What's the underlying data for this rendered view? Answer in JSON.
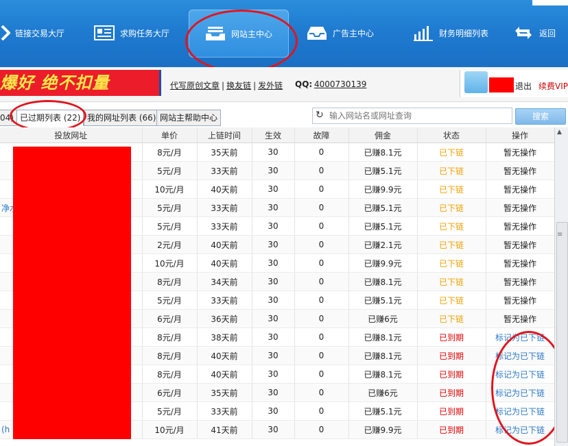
{
  "nav": {
    "items": [
      {
        "label": "链接交易大厅",
        "icon": "link-icon"
      },
      {
        "label": "求购任务大厅",
        "icon": "task-board-icon"
      },
      {
        "label": "网站主中心",
        "icon": "inbox-tray-icon"
      },
      {
        "label": "广告主中心",
        "icon": "inbox-icon"
      },
      {
        "label": "财务明细列表",
        "icon": "bar-chart-icon"
      },
      {
        "label": "返回",
        "icon": "return-arrows-icon"
      }
    ]
  },
  "banner": {
    "promo": "爆好 绝不扣量",
    "links": [
      "代写原创文章",
      "换友链",
      "发外链"
    ],
    "qq_label": "QQ:",
    "qq_number": "4000730139",
    "logout": "退出",
    "vip": "续费VIP"
  },
  "tabs": [
    {
      "label": "04)"
    },
    {
      "label": "已过期列表 (22)"
    },
    {
      "label": "我的网址列表 (66)"
    },
    {
      "label": "网站主帮助中心"
    }
  ],
  "search": {
    "placeholder": "输入网站名或网址查询",
    "button": "搜索"
  },
  "table": {
    "headers": [
      "投放网址",
      "单价",
      "上链时间",
      "生效",
      "故障",
      "佣金",
      "状态",
      "操作"
    ],
    "rows": [
      {
        "url": "",
        "price": "8元/月",
        "time": "35天前",
        "eff": "30",
        "fault": "0",
        "comm": "已赚8.1元",
        "status": "已下链",
        "op": "暂无操作"
      },
      {
        "url": "",
        "price": "5元/月",
        "time": "33天前",
        "eff": "30",
        "fault": "0",
        "comm": "已赚5.1元",
        "status": "已下链",
        "op": "暂无操作"
      },
      {
        "url": "",
        "price": "10元/月",
        "time": "40天前",
        "eff": "30",
        "fault": "0",
        "comm": "已赚9.9元",
        "status": "已下链",
        "op": "暂无操作"
      },
      {
        "url": "净水",
        "price": "5元/月",
        "time": "33天前",
        "eff": "30",
        "fault": "0",
        "comm": "已赚5.1元",
        "status": "已下链",
        "op": "暂无操作"
      },
      {
        "url": "",
        "price": "5元/月",
        "time": "33天前",
        "eff": "30",
        "fault": "0",
        "comm": "已赚5.1元",
        "status": "已下链",
        "op": "暂无操作"
      },
      {
        "url": "",
        "price": "2元/月",
        "time": "40天前",
        "eff": "30",
        "fault": "0",
        "comm": "已赚2.1元",
        "status": "已下链",
        "op": "暂无操作"
      },
      {
        "url": "",
        "price": "10元/月",
        "time": "40天前",
        "eff": "30",
        "fault": "0",
        "comm": "已赚9.9元",
        "status": "已下链",
        "op": "暂无操作"
      },
      {
        "url": "",
        "price": "8元/月",
        "time": "34天前",
        "eff": "30",
        "fault": "0",
        "comm": "已赚8.1元",
        "status": "已下链",
        "op": "暂无操作"
      },
      {
        "url": "",
        "price": "5元/月",
        "time": "33天前",
        "eff": "30",
        "fault": "0",
        "comm": "已赚5.1元",
        "status": "已下链",
        "op": "暂无操作"
      },
      {
        "url": "",
        "price": "6元/月",
        "time": "36天前",
        "eff": "30",
        "fault": "0",
        "comm": "已赚6元",
        "status": "已下链",
        "op": "暂无操作"
      },
      {
        "url": "",
        "price": "8元/月",
        "time": "38天前",
        "eff": "30",
        "fault": "0",
        "comm": "已赚8.1元",
        "status": "已到期",
        "op": "标记为已下链"
      },
      {
        "url": "",
        "price": "8元/月",
        "time": "40天前",
        "eff": "30",
        "fault": "0",
        "comm": "已赚8.1元",
        "status": "已到期",
        "op": "标记为已下链"
      },
      {
        "url": "",
        "price": "8元/月",
        "time": "40天前",
        "eff": "30",
        "fault": "0",
        "comm": "已赚8.1元",
        "status": "已到期",
        "op": "标记为已下链"
      },
      {
        "url": "",
        "price": "6元/月",
        "time": "35天前",
        "eff": "30",
        "fault": "0",
        "comm": "已赚6元",
        "status": "已到期",
        "op": "标记为已下链"
      },
      {
        "url": "",
        "price": "5元/月",
        "time": "33天前",
        "eff": "30",
        "fault": "0",
        "comm": "已赚5.1元",
        "status": "已到期",
        "op": "标记为已下链"
      },
      {
        "url": "(h",
        "price": "10元/月",
        "time": "41天前",
        "eff": "30",
        "fault": "0",
        "comm": "已赚9.9元",
        "status": "已到期",
        "op": "标记为已下链"
      }
    ]
  },
  "colors": {
    "nav_bg": "#1f7bd0",
    "status_down": "#f0a000",
    "status_expired": "#e00000",
    "link": "#2a77c6",
    "annotation_red": "#e0151e"
  }
}
